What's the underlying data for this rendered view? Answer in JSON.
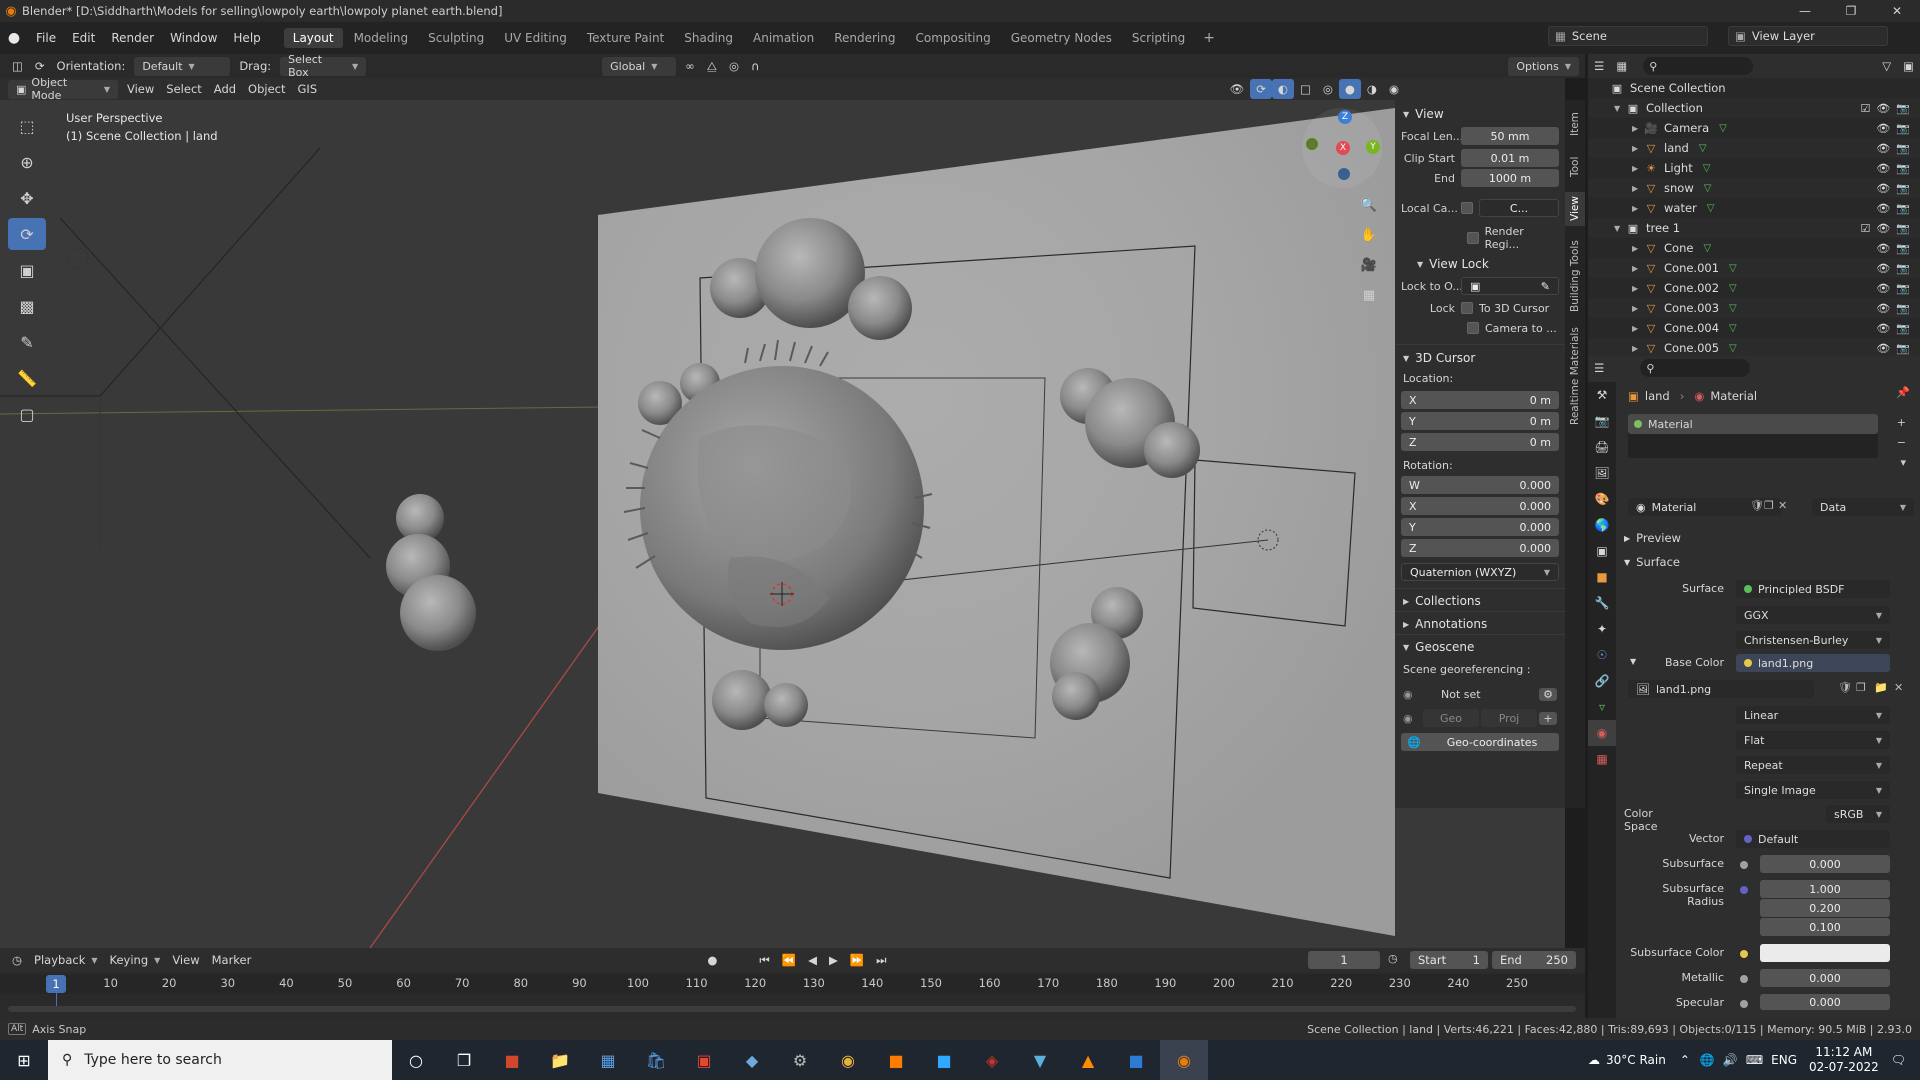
{
  "window": {
    "title": "Blender* [D:\\Siddharth\\Models for selling\\lowpoly earth\\lowpoly planet earth.blend]"
  },
  "menus": [
    "File",
    "Edit",
    "Render",
    "Window",
    "Help"
  ],
  "workspaces": [
    "Layout",
    "Modeling",
    "Sculpting",
    "UV Editing",
    "Texture Paint",
    "Shading",
    "Animation",
    "Rendering",
    "Compositing",
    "Geometry Nodes",
    "Scripting"
  ],
  "active_workspace": "Layout",
  "scene": {
    "name": "Scene",
    "view_layer": "View Layer"
  },
  "viewport_header": {
    "orientation_label": "Orientation:",
    "orientation_value": "Default",
    "drag_label": "Drag:",
    "drag_value": "Select Box",
    "transform_space": "Global",
    "options_label": "Options"
  },
  "viewport_header2": {
    "mode": "Object Mode",
    "menus": [
      "View",
      "Select",
      "Add",
      "Object",
      "GIS"
    ]
  },
  "viewport_info": {
    "line1": "User Perspective",
    "line2": "(1) Scene Collection | land"
  },
  "gizmo": {
    "x": "X",
    "y": "Y",
    "z": "Z"
  },
  "npanel": {
    "view_title": "View",
    "focal_label": "Focal Len...",
    "focal_value": "50 mm",
    "clip_start_label": "Clip Start",
    "clip_start_value": "0.01 m",
    "clip_end_label": "End",
    "clip_end_value": "1000 m",
    "local_camera_label": "Local Ca...",
    "local_camera_value": "C...",
    "render_region_label": "Render Regi...",
    "view_lock_title": "View Lock",
    "lock_to_label": "Lock to O...",
    "lock_label": "Lock",
    "lock_cursor_label": "To 3D Cursor",
    "lock_camera_label": "Camera to ...",
    "cursor_title": "3D Cursor",
    "location_label": "Location:",
    "loc_x": "0 m",
    "loc_y": "0 m",
    "loc_z": "0 m",
    "rotation_label": "Rotation:",
    "rot_w": "0.000",
    "rot_x": "0.000",
    "rot_y": "0.000",
    "rot_z": "0.000",
    "rotation_mode": "Quaternion (WXYZ)",
    "collections_title": "Collections",
    "annotations_title": "Annotations",
    "geoscene_title": "Geoscene",
    "georef_label": "Scene georeferencing :",
    "not_set_label": "Not set",
    "geo_btn": "Geo",
    "proj_btn": "Proj",
    "geo_coords_btn": "Geo-coordinates",
    "tabs": [
      "Item",
      "Tool",
      "View",
      "Building Tools",
      "Realtime Materials"
    ]
  },
  "outliner": {
    "root": "Scene Collection",
    "rows": [
      {
        "name": "Collection",
        "indent": 1,
        "type": "collection"
      },
      {
        "name": "Camera",
        "indent": 2,
        "type": "camera"
      },
      {
        "name": "land",
        "indent": 2,
        "type": "mesh"
      },
      {
        "name": "Light",
        "indent": 2,
        "type": "light"
      },
      {
        "name": "snow",
        "indent": 2,
        "type": "mesh"
      },
      {
        "name": "water",
        "indent": 2,
        "type": "mesh"
      },
      {
        "name": "tree 1",
        "indent": 1,
        "type": "collection"
      },
      {
        "name": "Cone",
        "indent": 2,
        "type": "mesh"
      },
      {
        "name": "Cone.001",
        "indent": 2,
        "type": "mesh"
      },
      {
        "name": "Cone.002",
        "indent": 2,
        "type": "mesh"
      },
      {
        "name": "Cone.003",
        "indent": 2,
        "type": "mesh"
      },
      {
        "name": "Cone.004",
        "indent": 2,
        "type": "mesh"
      },
      {
        "name": "Cone.005",
        "indent": 2,
        "type": "mesh"
      }
    ]
  },
  "properties": {
    "object_name": "land",
    "tab_name": "Material",
    "slot_name": "Material",
    "material_name": "Material",
    "link_value": "Data",
    "preview_label": "Preview",
    "surface_section": "Surface",
    "surface_label": "Surface",
    "surface_value": "Principled BSDF",
    "distribution": "GGX",
    "subsurface_method": "Christensen-Burley",
    "base_color_label": "Base Color",
    "base_color_value": "land1.png",
    "image_name": "land1.png",
    "interpolation": "Linear",
    "projection": "Flat",
    "extension": "Repeat",
    "source": "Single Image",
    "color_space_label": "Color Space",
    "color_space_value": "sRGB",
    "vector_label": "Vector",
    "vector_value": "Default",
    "subsurface_label": "Subsurface",
    "subsurface_value": "0.000",
    "subsurface_radius_label": "Subsurface Radius",
    "subsurface_radius": [
      "1.000",
      "0.200",
      "0.100"
    ],
    "subsurface_color_label": "Subsurface Color",
    "metallic_label": "Metallic",
    "metallic_value": "0.000",
    "specular_label": "Specular",
    "specular_value": "0.000"
  },
  "timeline": {
    "menus": [
      "Playback",
      "Keying",
      "View",
      "Marker"
    ],
    "current_frame": "1",
    "start_label": "Start",
    "start_value": "1",
    "end_label": "End",
    "end_value": "250",
    "ticks": [
      "10",
      "20",
      "30",
      "40",
      "50",
      "60",
      "70",
      "80",
      "90",
      "100",
      "110",
      "120",
      "130",
      "140",
      "150",
      "160",
      "170",
      "180",
      "190",
      "200",
      "210",
      "220",
      "230",
      "240",
      "250"
    ],
    "marker_frame": "1"
  },
  "statusbar": {
    "left": "Axis Snap",
    "right": "Scene Collection | land | Verts:46,221 | Faces:42,880 | Tris:89,693 | Objects:0/115 | Memory: 90.5 MiB | 2.93.0"
  },
  "taskbar": {
    "search_placeholder": "Type here to search",
    "weather": "30°C  Rain",
    "language": "ENG",
    "time": "11:12 AM",
    "date": "02-07-2022"
  },
  "colors": {
    "accent": "#4772b3",
    "viewport_bg": "#393939",
    "blender_orange": "#e87d0d"
  }
}
